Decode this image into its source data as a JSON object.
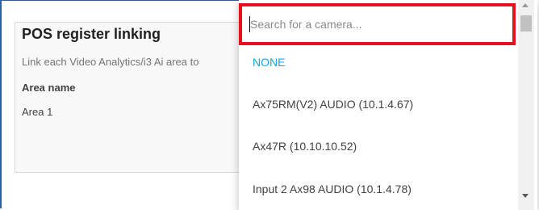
{
  "card": {
    "title": "POS register linking",
    "description": "Link each Video Analytics/i3 Ai area to",
    "area_header": "Area name",
    "areas": [
      "Area 1"
    ]
  },
  "dropdown": {
    "search_placeholder": "Search for a camera...",
    "search_value": "",
    "options": [
      {
        "label": "NONE"
      },
      {
        "label": "Ax75RM(V2) AUDIO (10.1.4.67)"
      },
      {
        "label": "Ax47R (10.10.10.52)"
      },
      {
        "label": "Input 2 Ax98 AUDIO (10.1.4.78)"
      }
    ]
  },
  "colors": {
    "highlight_border": "#e8101a",
    "none_option": "#1aa3e8",
    "frame_border": "#2f5f9e"
  },
  "icons": {
    "scroll_up": "scroll-up-arrow-icon",
    "scroll_down": "scroll-down-arrow-icon"
  }
}
